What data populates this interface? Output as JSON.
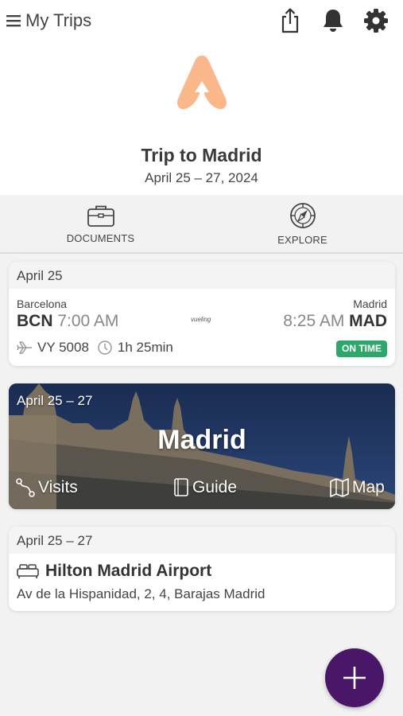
{
  "header": {
    "menu_label": "My Trips",
    "icons": [
      "hamburger-icon",
      "share-icon",
      "bell-icon",
      "gear-icon"
    ]
  },
  "trip": {
    "logo": "app-logo-icon",
    "title": "Trip to Madrid",
    "dates": "April 25 – 27, 2024"
  },
  "tabs": [
    {
      "label": "DOCUMENTS",
      "icon": "briefcase-icon"
    },
    {
      "label": "EXPLORE",
      "icon": "compass-icon"
    }
  ],
  "flight": {
    "date": "April 25",
    "origin_city": "Barcelona",
    "origin_code": "BCN",
    "depart_time": "7:00 AM",
    "airline": "vueling",
    "dest_city": "Madrid",
    "arrive_time": "8:25 AM",
    "dest_code": "MAD",
    "flight_number": "VY 5008",
    "duration": "1h 25min",
    "status": "ON TIME",
    "status_color": "#2ea86a"
  },
  "destination": {
    "dates": "April 25 – 27",
    "name": "Madrid",
    "actions": [
      {
        "label": "Visits",
        "icon": "route-icon"
      },
      {
        "label": "Guide",
        "icon": "book-icon"
      },
      {
        "label": "Map",
        "icon": "map-icon"
      }
    ]
  },
  "hotel": {
    "dates": "April 25 – 27",
    "name": "Hilton Madrid Airport",
    "address": "Av de la Hispanidad, 2, 4, Barajas Madrid",
    "icon": "bed-icon"
  },
  "fab": {
    "icon": "plus-icon",
    "color": "#4a1668"
  },
  "colors": {
    "accent": "#4a1668",
    "logo": "#f9b78a",
    "status": "#2ea86a"
  }
}
